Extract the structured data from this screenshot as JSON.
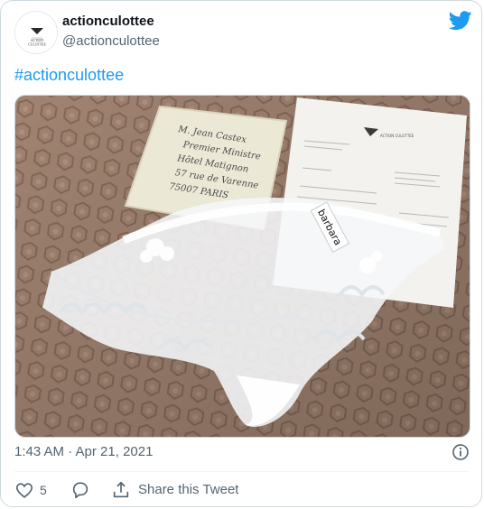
{
  "user": {
    "display_name": "actionculottee",
    "handle": "@actionculottee",
    "avatar_text_top": "ACTION",
    "avatar_text_bottom": "CULOTTEE"
  },
  "tweet": {
    "text": "#actionculottee",
    "timestamp": "1:43 AM · Apr 21, 2021"
  },
  "photo": {
    "envelope_lines": [
      "M. Jean Castex",
      "Premier Ministre",
      "Hôtel Matignon",
      "57 rue de Varenne",
      "75007 PARIS"
    ],
    "tag_text": "barbara",
    "letter_header": "ACTION CULOTTEE"
  },
  "actions": {
    "like_count": "5",
    "share_label": "Share this Tweet"
  },
  "colors": {
    "brand_blue": "#1d9bf0",
    "secondary_text": "#536471",
    "border": "#cfd9de"
  },
  "icons": {
    "brand": "twitter-bird-icon",
    "info": "info-icon",
    "like": "heart-icon",
    "reply": "reply-bubble-icon",
    "share": "share-upload-icon"
  }
}
